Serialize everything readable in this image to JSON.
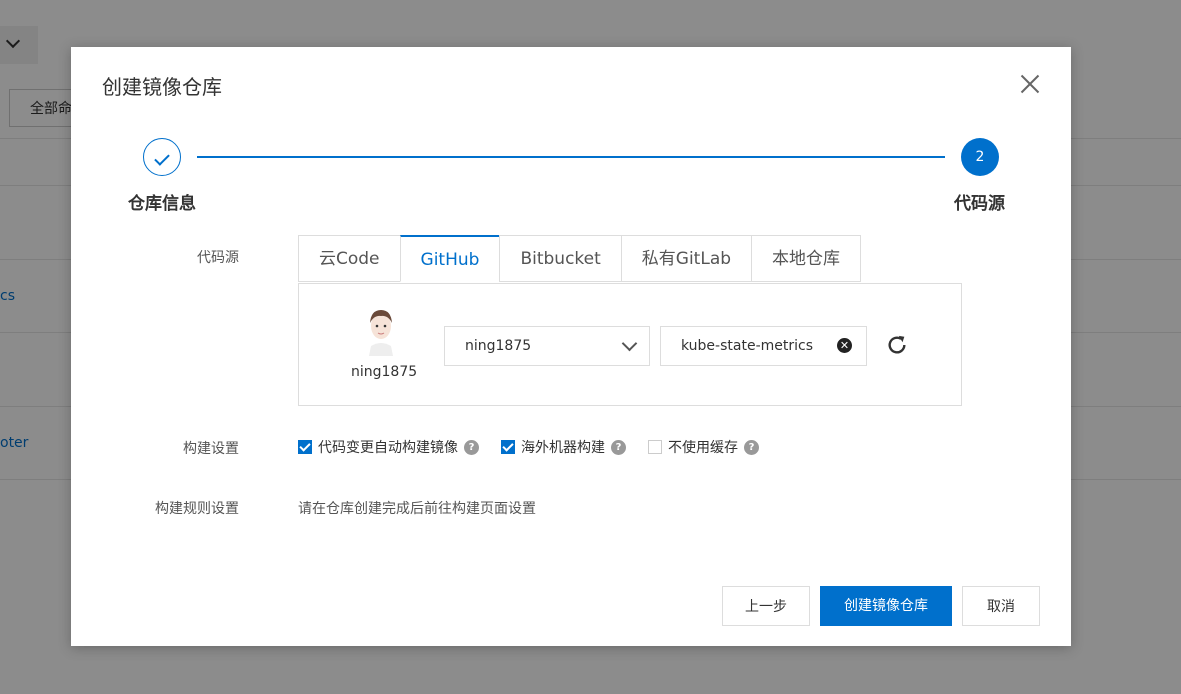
{
  "background": {
    "button_partial": "全部命",
    "links": [
      "cs",
      "oter"
    ]
  },
  "modal": {
    "title": "创建镜像仓库",
    "steps": [
      {
        "label": "仓库信息",
        "state": "done"
      },
      {
        "label": "代码源",
        "number": "2",
        "state": "active"
      }
    ],
    "code_source": {
      "label": "代码源",
      "tabs": [
        {
          "label": "云Code"
        },
        {
          "label": "GitHub",
          "active": true
        },
        {
          "label": "Bitbucket"
        },
        {
          "label": "私有GitLab"
        },
        {
          "label": "本地仓库"
        }
      ],
      "username": "ning1875",
      "org_select": "ning1875",
      "repo_value": "kube-state-metrics"
    },
    "build_settings": {
      "label": "构建设置",
      "options": [
        {
          "label": "代码变更自动构建镜像",
          "checked": true
        },
        {
          "label": "海外机器构建",
          "checked": true
        },
        {
          "label": "不使用缓存",
          "checked": false
        }
      ]
    },
    "build_rules": {
      "label": "构建规则设置",
      "hint": "请在仓库创建完成后前往构建页面设置"
    },
    "buttons": {
      "prev": "上一步",
      "create": "创建镜像仓库",
      "cancel": "取消"
    }
  },
  "colors": {
    "primary": "#0070cc",
    "overlay": "rgba(0,0,0,0.45)"
  }
}
